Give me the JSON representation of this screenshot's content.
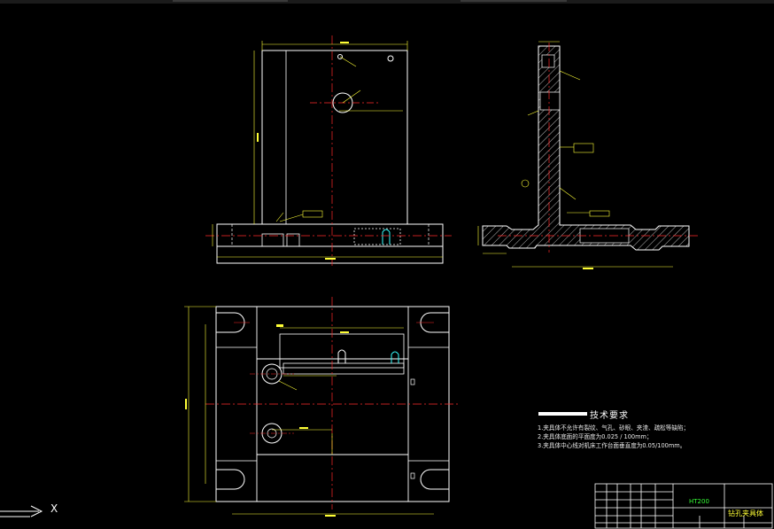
{
  "tech_requirements": {
    "title": "技术要求",
    "items": [
      "1.夹具体不允许有裂纹、气孔、砂眼、夹渣、疏松等缺陷；",
      "2.夹具体底面的平面度为0.025 / 100mm；",
      "3.夹具体中心线对机床工作台面垂直度为0.05/100mm。"
    ]
  },
  "title_block": {
    "material": "HT200",
    "drawing_name": "钻孔夹具体"
  },
  "ucs_icon": {
    "x_label": "X"
  },
  "colors": {
    "background": "#000000",
    "outline": "#ffffff",
    "dimension": "#ffff36",
    "centerline": "#ff2a2a",
    "hatch": "#ffffff",
    "title_text_green": "#36ff36"
  }
}
